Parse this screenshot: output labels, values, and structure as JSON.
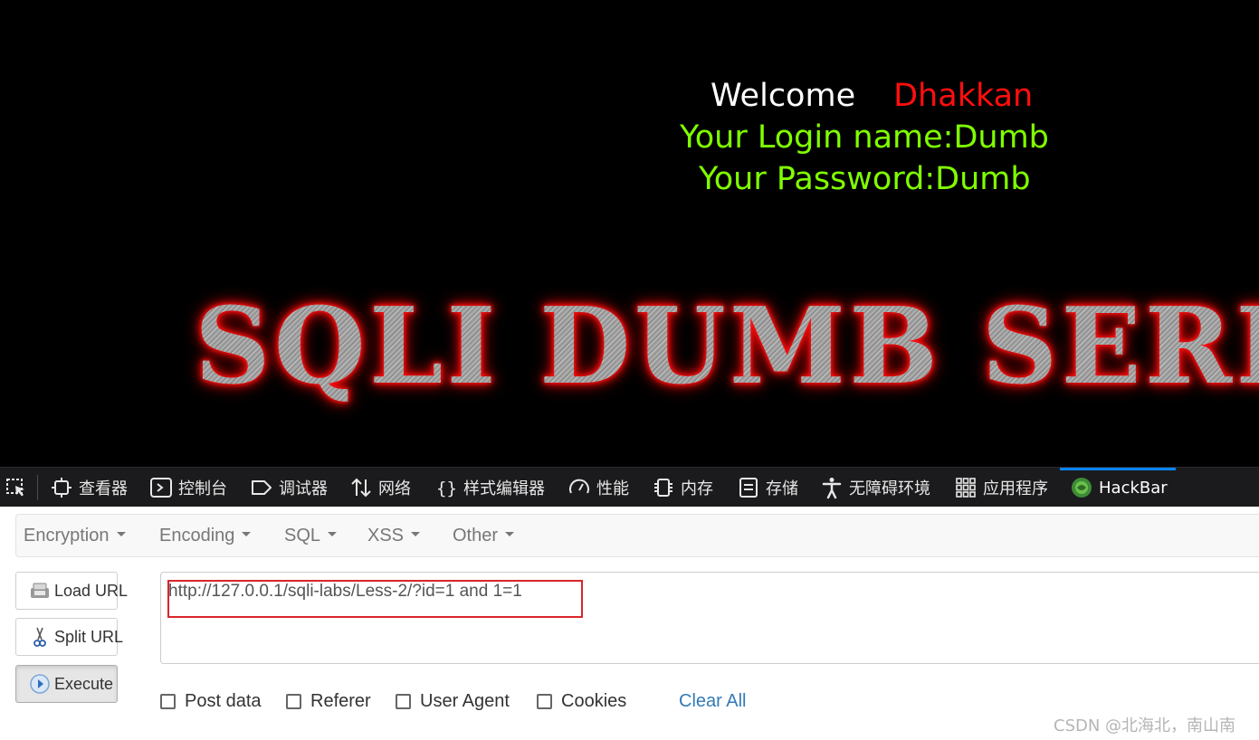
{
  "content": {
    "welcome_label": "Welcome",
    "welcome_user": "Dhakkan",
    "login_line": "Your Login name:Dumb",
    "password_line": "Your Password:Dumb",
    "banner": "SQLI DUMB SERIES"
  },
  "devtools": {
    "tabs": [
      {
        "label": "查看器",
        "icon": "inspector-icon"
      },
      {
        "label": "控制台",
        "icon": "console-icon"
      },
      {
        "label": "调试器",
        "icon": "debugger-icon"
      },
      {
        "label": "网络",
        "icon": "network-icon"
      },
      {
        "label": "样式编辑器",
        "icon": "style-editor-icon"
      },
      {
        "label": "性能",
        "icon": "performance-icon"
      },
      {
        "label": "内存",
        "icon": "memory-icon"
      },
      {
        "label": "存储",
        "icon": "storage-icon"
      },
      {
        "label": "无障碍环境",
        "icon": "accessibility-icon"
      },
      {
        "label": "应用程序",
        "icon": "application-icon"
      },
      {
        "label": "HackBar",
        "icon": "hackbar-icon",
        "active": true
      }
    ]
  },
  "hackbar": {
    "menus": [
      "Encryption",
      "Encoding",
      "SQL",
      "XSS",
      "Other"
    ],
    "buttons": {
      "load_url": "Load URL",
      "split_url": "Split URL",
      "execute": "Execute"
    },
    "url_value": "http://127.0.0.1/sqli-labs/Less-2/?id=1 and 1=1",
    "options": [
      "Post data",
      "Referer",
      "User Agent",
      "Cookies"
    ],
    "clear_all": "Clear All"
  },
  "watermark": "CSDN @北海北，南山南",
  "colors": {
    "welcome_user": "#ff0e0e",
    "login_text": "#80ff00",
    "link": "#337ab7",
    "active_tab": "#0a84ff",
    "highlight_box": "#d9262b"
  }
}
